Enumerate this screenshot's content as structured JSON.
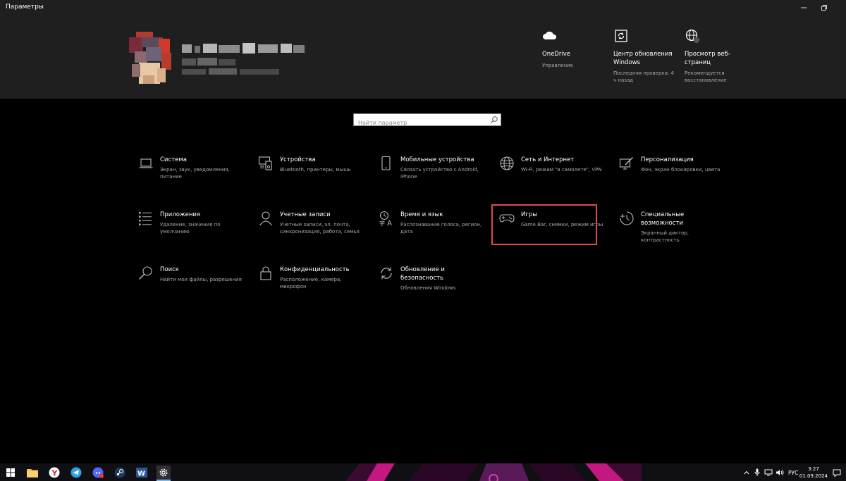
{
  "window": {
    "title": "Параметры"
  },
  "header": {
    "tiles": [
      {
        "title": "OneDrive",
        "subtitle": "Управление"
      },
      {
        "title": "Центр обновления Windows",
        "subtitle": "Последняя проверка: 4 ч назад"
      },
      {
        "title": "Просмотр веб-страниц",
        "subtitle": "Рекомендуется восстановление"
      }
    ]
  },
  "search": {
    "placeholder": "Найти параметр"
  },
  "categories": [
    {
      "title": "Система",
      "subtitle": "Экран, звук, уведомления, питание",
      "icon": "laptop-icon"
    },
    {
      "title": "Устройства",
      "subtitle": "Bluetooth, принтеры, мышь",
      "icon": "devices-icon"
    },
    {
      "title": "Мобильные устройства",
      "subtitle": "Связать устройство с Android, iPhone",
      "icon": "phone-icon"
    },
    {
      "title": "Сеть и Интернет",
      "subtitle": "Wi-Fi, режим \"в самолете\", VPN",
      "icon": "globe-icon"
    },
    {
      "title": "Персонализация",
      "subtitle": "Фон, экран блокировки, цвета",
      "icon": "paint-icon"
    },
    {
      "title": "Приложения",
      "subtitle": "Удаление, значения по умолчанию",
      "icon": "apps-list-icon"
    },
    {
      "title": "Учетные записи",
      "subtitle": "Учетные записи, эл. почта, синхронизация, работа, семья",
      "icon": "person-icon"
    },
    {
      "title": "Время и язык",
      "subtitle": "Распознавание голоса, регион, дата",
      "icon": "time-language-icon"
    },
    {
      "title": "Игры",
      "subtitle": "Game Bar, снимки, режим игры",
      "icon": "gamepad-icon"
    },
    {
      "title": "Специальные возможности",
      "subtitle": "Экранный диктор, контрастность",
      "icon": "accessibility-icon"
    },
    {
      "title": "Поиск",
      "subtitle": "Найти мои файлы, разрешения",
      "icon": "search-icon"
    },
    {
      "title": "Конфиденциальность",
      "subtitle": "Расположение, камера, микрофон",
      "icon": "lock-icon"
    },
    {
      "title": "Обновление и безопасность",
      "subtitle": "Обновления Windows",
      "icon": "sync-icon"
    }
  ],
  "taskbar": {
    "language": "РУС",
    "time": "3:27",
    "date": "01.09.2024"
  },
  "colors": {
    "highlight": "#e04848",
    "header_bg": "#1f1f1f",
    "background": "#000000"
  }
}
